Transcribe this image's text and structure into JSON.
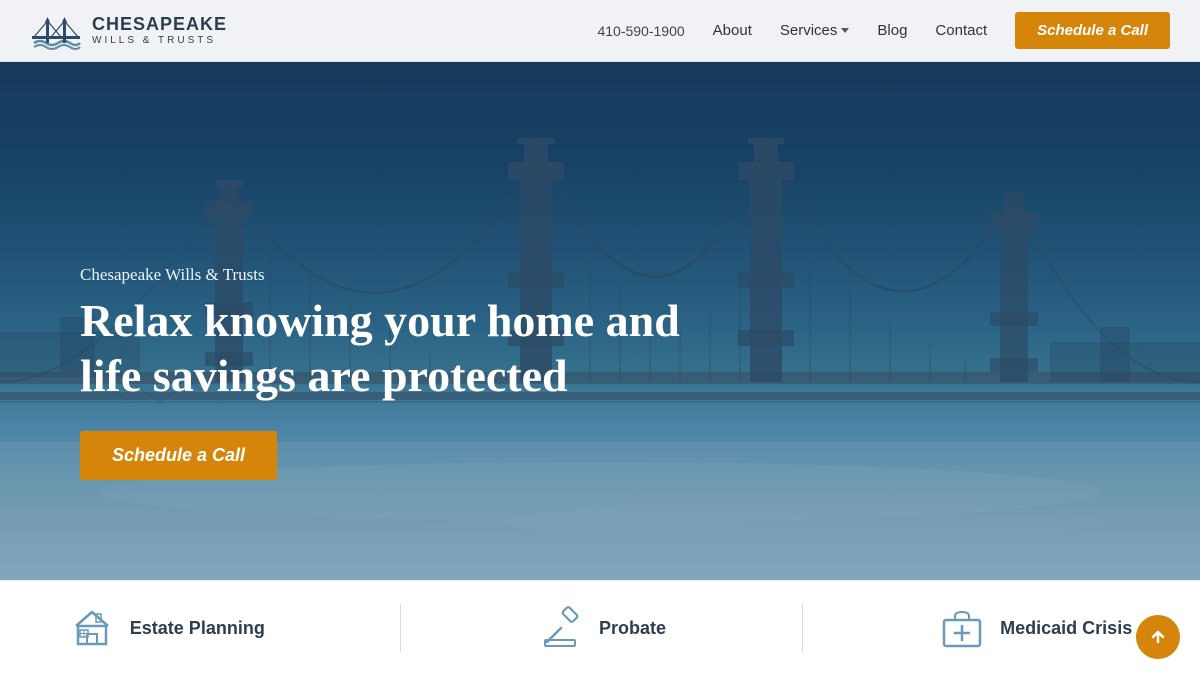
{
  "header": {
    "logo_title": "CHESAPEAKE",
    "logo_subtitle": "WILLS & TRUSTS",
    "phone": "410-590-1900",
    "nav": [
      {
        "id": "about",
        "label": "About",
        "has_dropdown": false
      },
      {
        "id": "services",
        "label": "Services",
        "has_dropdown": true
      },
      {
        "id": "blog",
        "label": "Blog",
        "has_dropdown": false
      },
      {
        "id": "contact",
        "label": "Contact",
        "has_dropdown": false
      }
    ],
    "cta_label": "Schedule a Call"
  },
  "hero": {
    "subtitle": "Chesapeake Wills & Trusts",
    "title": "Relax knowing your home and life savings are protected",
    "cta_label": "Schedule a Call"
  },
  "services": [
    {
      "id": "estate-planning",
      "label": "Estate Planning",
      "icon": "house-icon"
    },
    {
      "id": "probate",
      "label": "Probate",
      "icon": "gavel-icon"
    },
    {
      "id": "medicaid-crisis",
      "label": "Medicaid Crisis",
      "icon": "medical-icon"
    }
  ],
  "floating_btn": {
    "icon": "arrow-up-icon"
  }
}
